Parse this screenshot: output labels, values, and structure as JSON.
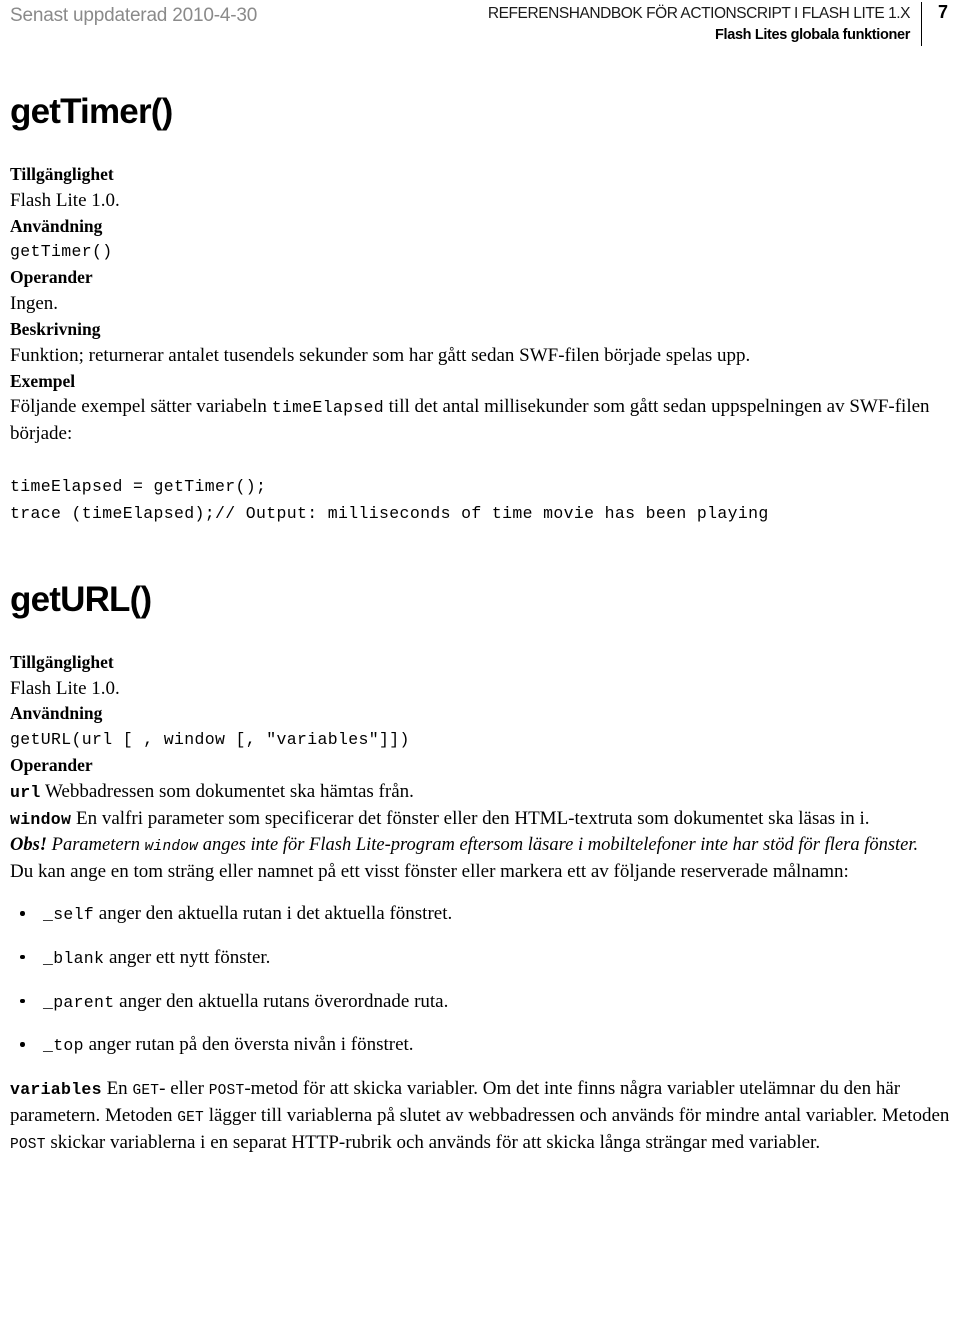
{
  "header": {
    "last_updated": "Senast uppdaterad 2010-4-30",
    "book_title": "REFERENSHANDBOK FÖR ACTIONSCRIPT I FLASH LITE 1.X",
    "chapter_title": "Flash Lites globala funktioner",
    "page_number": "7"
  },
  "sections": [
    {
      "title": "getTimer()",
      "availability": {
        "heading": "Tillgänglighet",
        "text": "Flash Lite 1.0."
      },
      "usage": {
        "heading": "Användning",
        "code": "getTimer()"
      },
      "operands": {
        "heading": "Operander",
        "text": "Ingen."
      },
      "description": {
        "heading": "Beskrivning",
        "text": "Funktion; returnerar antalet tusendels sekunder som har gått sedan SWF-filen började spelas upp."
      },
      "example": {
        "heading": "Exempel",
        "intro_part1": "Följande exempel sätter variabeln ",
        "intro_code": "timeElapsed",
        "intro_part2": " till det antal millisekunder som gått sedan uppspelningen av SWF-filen började:",
        "code": "timeElapsed = getTimer();\ntrace (timeElapsed);// Output: milliseconds of time movie has been playing"
      }
    },
    {
      "title": "getURL()",
      "availability": {
        "heading": "Tillgänglighet",
        "text": "Flash Lite 1.0."
      },
      "usage": {
        "heading": "Användning",
        "code": "getURL(url [ , window [, \"variables\"]])"
      },
      "operands": {
        "heading": "Operander",
        "url_name": "url",
        "url_text": " Webbadressen som dokumentet ska hämtas från.",
        "window_name": "window",
        "window_text": " En valfri parameter som specificerar det fönster eller den HTML-textruta som dokumentet ska läsas in i.",
        "note_label": "Obs!",
        "note_part1": " Parametern ",
        "note_code": "window",
        "note_part2": " anges inte för Flash Lite-program eftersom läsare i mobiltelefoner inte har stöd för flera fönster.",
        "targets_intro": "Du kan ange en tom sträng eller namnet på ett visst fönster eller markera ett av följande reserverade målnamn:",
        "targets": [
          {
            "code": "_self",
            "text": " anger den aktuella rutan i det aktuella fönstret."
          },
          {
            "code": "_blank",
            "text": " anger ett nytt fönster."
          },
          {
            "code": "_parent",
            "text": " anger den aktuella rutans överordnade ruta."
          },
          {
            "code": "_top",
            "text": " anger rutan på den översta nivån i fönstret."
          }
        ],
        "variables_name": "variables",
        "variables_part1": " En ",
        "variables_get1": "GET",
        "variables_part2": "- eller ",
        "variables_post1": "POST",
        "variables_part3": "-metod för att skicka variabler. Om det inte finns några variabler utelämnar du den här parametern. Metoden ",
        "variables_get2": "GET",
        "variables_part4": " lägger till variablerna på slutet av webbadressen och används för mindre antal variabler. Metoden ",
        "variables_post2": "POST",
        "variables_part5": " skickar variablerna i en separat HTTP-rubrik och används för att skicka långa strängar med variabler."
      }
    }
  ]
}
